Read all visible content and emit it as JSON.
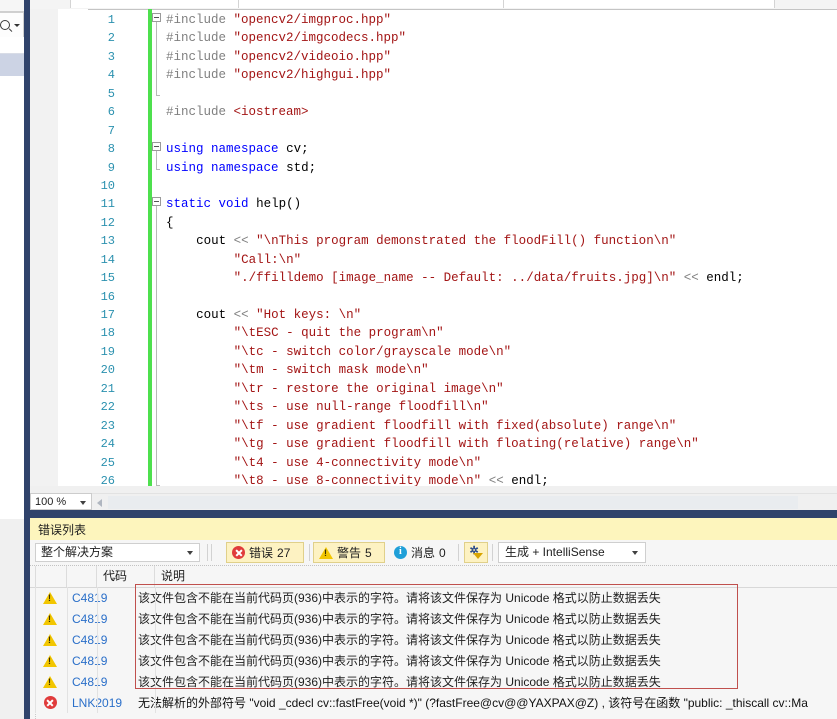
{
  "editor": {
    "zoom_level": "100 %",
    "line_numbers": [
      1,
      2,
      3,
      4,
      5,
      6,
      7,
      8,
      9,
      10,
      11,
      12,
      13,
      14,
      15,
      16,
      17,
      18,
      19,
      20,
      21,
      22,
      23,
      24,
      25,
      26
    ],
    "code_lines": [
      "#include \"opencv2/imgproc.hpp\"",
      "#include \"opencv2/imgcodecs.hpp\"",
      "#include \"opencv2/videoio.hpp\"",
      "#include \"opencv2/highgui.hpp\"",
      "",
      "#include <iostream>",
      "",
      "using namespace cv;",
      "using namespace std;",
      "",
      "static void help()",
      "{",
      "    cout << \"\\nThis program demonstrated the floodFill() function\\n\"",
      "         \"Call:\\n\"",
      "         \"./ffilldemo [image_name -- Default: ../data/fruits.jpg]\\n\" << endl;",
      "",
      "    cout << \"Hot keys: \\n\"",
      "         \"\\tESC - quit the program\\n\"",
      "         \"\\tc - switch color/grayscale mode\\n\"",
      "         \"\\tm - switch mask mode\\n\"",
      "         \"\\tr - restore the original image\\n\"",
      "         \"\\ts - use null-range floodfill\\n\"",
      "         \"\\tf - use gradient floodfill with fixed(absolute) range\\n\"",
      "         \"\\tg - use gradient floodfill with floating(relative) range\\n\"",
      "         \"\\t4 - use 4-connectivity mode\\n\"",
      "         \"\\t8 - use 8-connectivity mode\\n\" << endl;"
    ]
  },
  "error_panel": {
    "title": "错误列表",
    "scope_filter": "整个解决方案",
    "error_button": {
      "label": "错误",
      "count": "27"
    },
    "warning_button": {
      "label": "警告",
      "count": "5"
    },
    "message_button": {
      "label": "消息",
      "count": "0"
    },
    "source_filter": "生成 + IntelliSense",
    "columns": [
      "",
      "",
      "代码",
      "说明"
    ],
    "rows": [
      {
        "severity": "warning",
        "code": "C4819",
        "description": "该文件包含不能在当前代码页(936)中表示的字符。请将该文件保存为 Unicode 格式以防止数据丢失"
      },
      {
        "severity": "warning",
        "code": "C4819",
        "description": "该文件包含不能在当前代码页(936)中表示的字符。请将该文件保存为 Unicode 格式以防止数据丢失"
      },
      {
        "severity": "warning",
        "code": "C4819",
        "description": "该文件包含不能在当前代码页(936)中表示的字符。请将该文件保存为 Unicode 格式以防止数据丢失"
      },
      {
        "severity": "warning",
        "code": "C4819",
        "description": "该文件包含不能在当前代码页(936)中表示的字符。请将该文件保存为 Unicode 格式以防止数据丢失"
      },
      {
        "severity": "warning",
        "code": "C4819",
        "description": "该文件包含不能在当前代码页(936)中表示的字符。请将该文件保存为 Unicode 格式以防止数据丢失"
      },
      {
        "severity": "error",
        "code": "LNK2019",
        "description": "无法解析的外部符号 \"void _cdecl cv::fastFree(void *)\" (?fastFree@cv@@YAXPAX@Z) , 该符号在函数 \"public: _thiscall cv::Ma"
      }
    ]
  }
}
